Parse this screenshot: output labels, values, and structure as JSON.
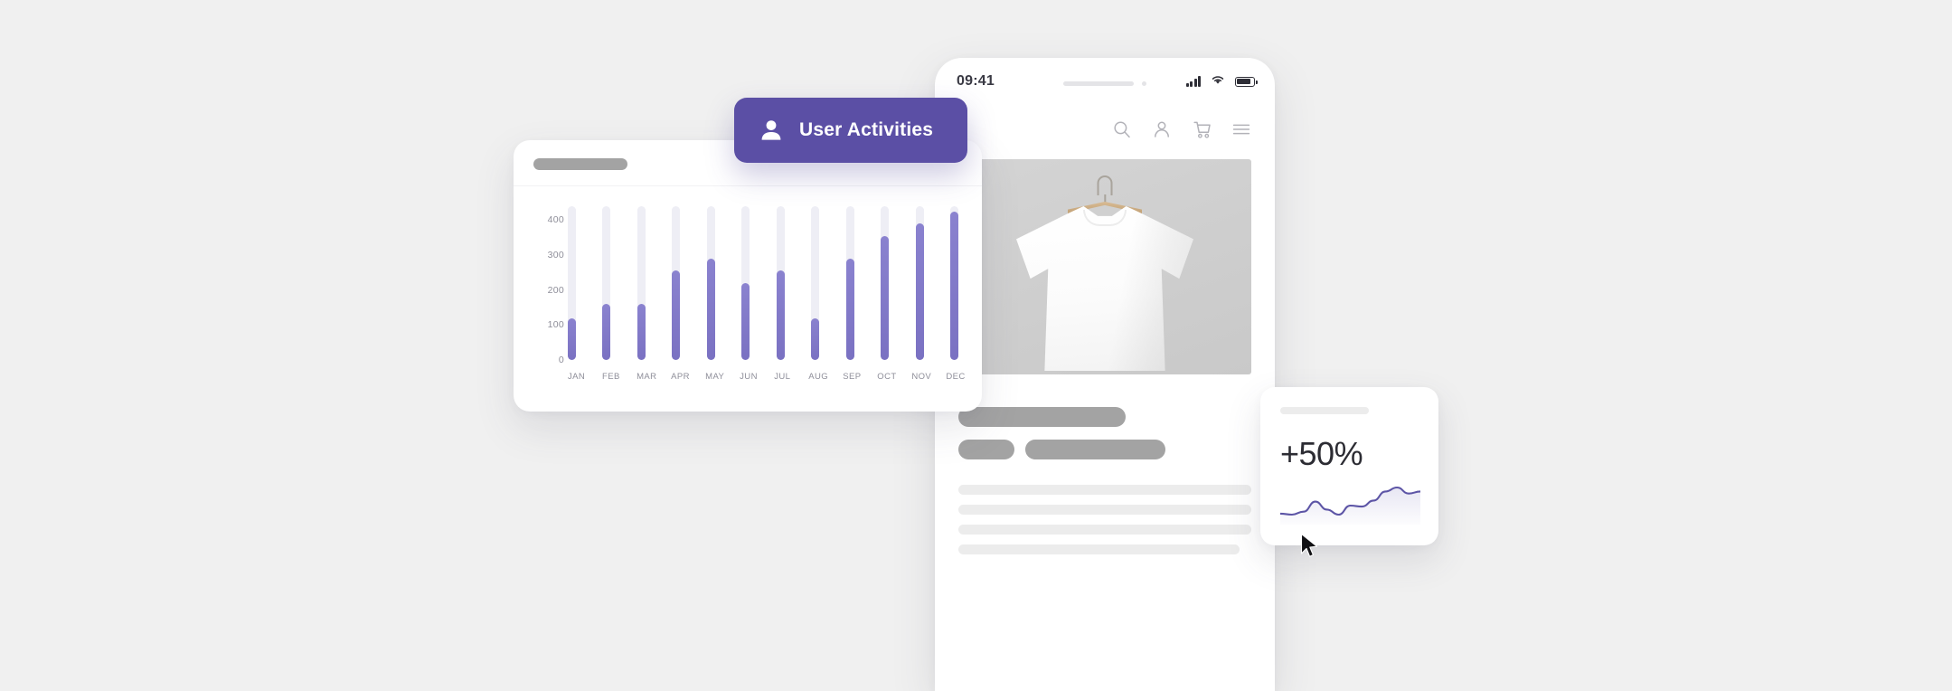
{
  "badge": {
    "label": "User Activities",
    "icon": "person-icon",
    "color": "#5b4fa5"
  },
  "chart_card": {
    "header_placeholder": "",
    "chart_data": {
      "type": "bar",
      "title": "User Activities",
      "xlabel": "",
      "ylabel": "",
      "categories": [
        "JAN",
        "FEB",
        "MAR",
        "APR",
        "MAY",
        "JUN",
        "JUL",
        "AUG",
        "SEP",
        "OCT",
        "NOV",
        "DEC"
      ],
      "values": [
        120,
        160,
        160,
        255,
        290,
        220,
        255,
        120,
        290,
        355,
        390,
        425
      ],
      "ytick_labels": [
        "0",
        "100",
        "200",
        "300",
        "400"
      ],
      "ytick_values": [
        0,
        100,
        200,
        300,
        400
      ],
      "ylim": [
        0,
        440
      ],
      "grid": false,
      "legend": false,
      "bar_color": "#7a71c2",
      "track_color": "#eeeef5"
    }
  },
  "phone": {
    "status_bar": {
      "time": "09:41",
      "signal_icon": "cellular-signal-icon",
      "wifi_icon": "wifi-icon",
      "battery_icon": "battery-icon"
    },
    "nav_icons": [
      {
        "name": "search-icon"
      },
      {
        "name": "account-icon"
      },
      {
        "name": "shopping-cart-icon"
      },
      {
        "name": "hamburger-menu-icon"
      }
    ],
    "product_image": {
      "alt": "white t-shirt on wooden hanger"
    },
    "skeleton": {
      "title_bar": "",
      "sub_bar_small": "",
      "sub_bar_medium": "",
      "text_lines": [
        "",
        "",
        "",
        ""
      ]
    }
  },
  "stat_card": {
    "header_placeholder": "",
    "value": "+50%",
    "sparkline": {
      "type": "line",
      "color": "#5d55a6",
      "values": [
        18,
        17,
        20,
        30,
        22,
        17,
        26,
        25,
        31,
        40,
        44,
        38,
        40
      ]
    }
  },
  "cursor": {
    "name": "mouse-pointer-icon"
  }
}
